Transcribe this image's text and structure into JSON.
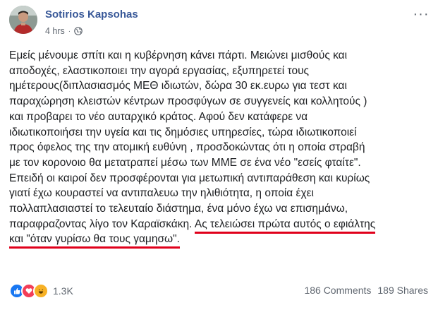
{
  "author": {
    "name": "Sotirios Kapsohas",
    "time": "4 hrs",
    "separator": "·"
  },
  "more_label": "···",
  "post": {
    "lines": [
      "Εμείς μένουμε σπίτι και η κυβέρνηση κάνει πάρτι. Μειώνει μισθούς και",
      "αποδοχές, ελαστικοποιει την αγορά εργασίας, εξυπηρετεί τους",
      "ημέτερους(διπλασιασμός ΜΕΘ ιδιωτών, δώρα 30 εκ.ευρω για τεστ και",
      "παραχώρηση κλειστών κέντρων προσφύγων σε συγγενείς και κολλητούς )",
      "και προβαρει το νέο αυταρχικό κράτος. Αφού δεν κατάφερε να",
      "ιδιωτικοποιήσει την υγεία και τις δημόσιες υπηρεσίες, τώρα ιδιωτικοποιεί",
      "προς όφελος της την ατομική ευθύνη , προσδοκώντας ότι η οποία στραβή",
      "με τον κορονοιο θα μετατραπεί μέσω των ΜΜΕ σε ένα νέο \"εσείς φταίτε\".",
      "Επειδή οι καιροί δεν προσφέρονται για μετωπική αντιπαράθεση και κυρίως",
      "γιατί έχω κουραστεί να αντιπαλευω την ηλιθιότητα, η οποία έχει",
      "πολλαπλασιαστεί το τελευταίο διάστημα, ένα μόνο έχω να επισημάνω,"
    ],
    "line12_plain": "παραφραζοντας λίγο τον Καραϊσκάκη. ",
    "line12_highlight": "Ας τελειώσει πρώτα αυτός ο εφιάλτης",
    "line13_highlight": "και \"όταν γυρίσω θα τους γαμησω\"."
  },
  "footer": {
    "reactions_count": "1.3K",
    "comments": "186 Comments",
    "shares": "189 Shares"
  },
  "colors": {
    "name_link": "#385898",
    "underline": "#e0001b",
    "like": "#1877f2",
    "love": "#f33e58",
    "haha": "#f7b125"
  }
}
